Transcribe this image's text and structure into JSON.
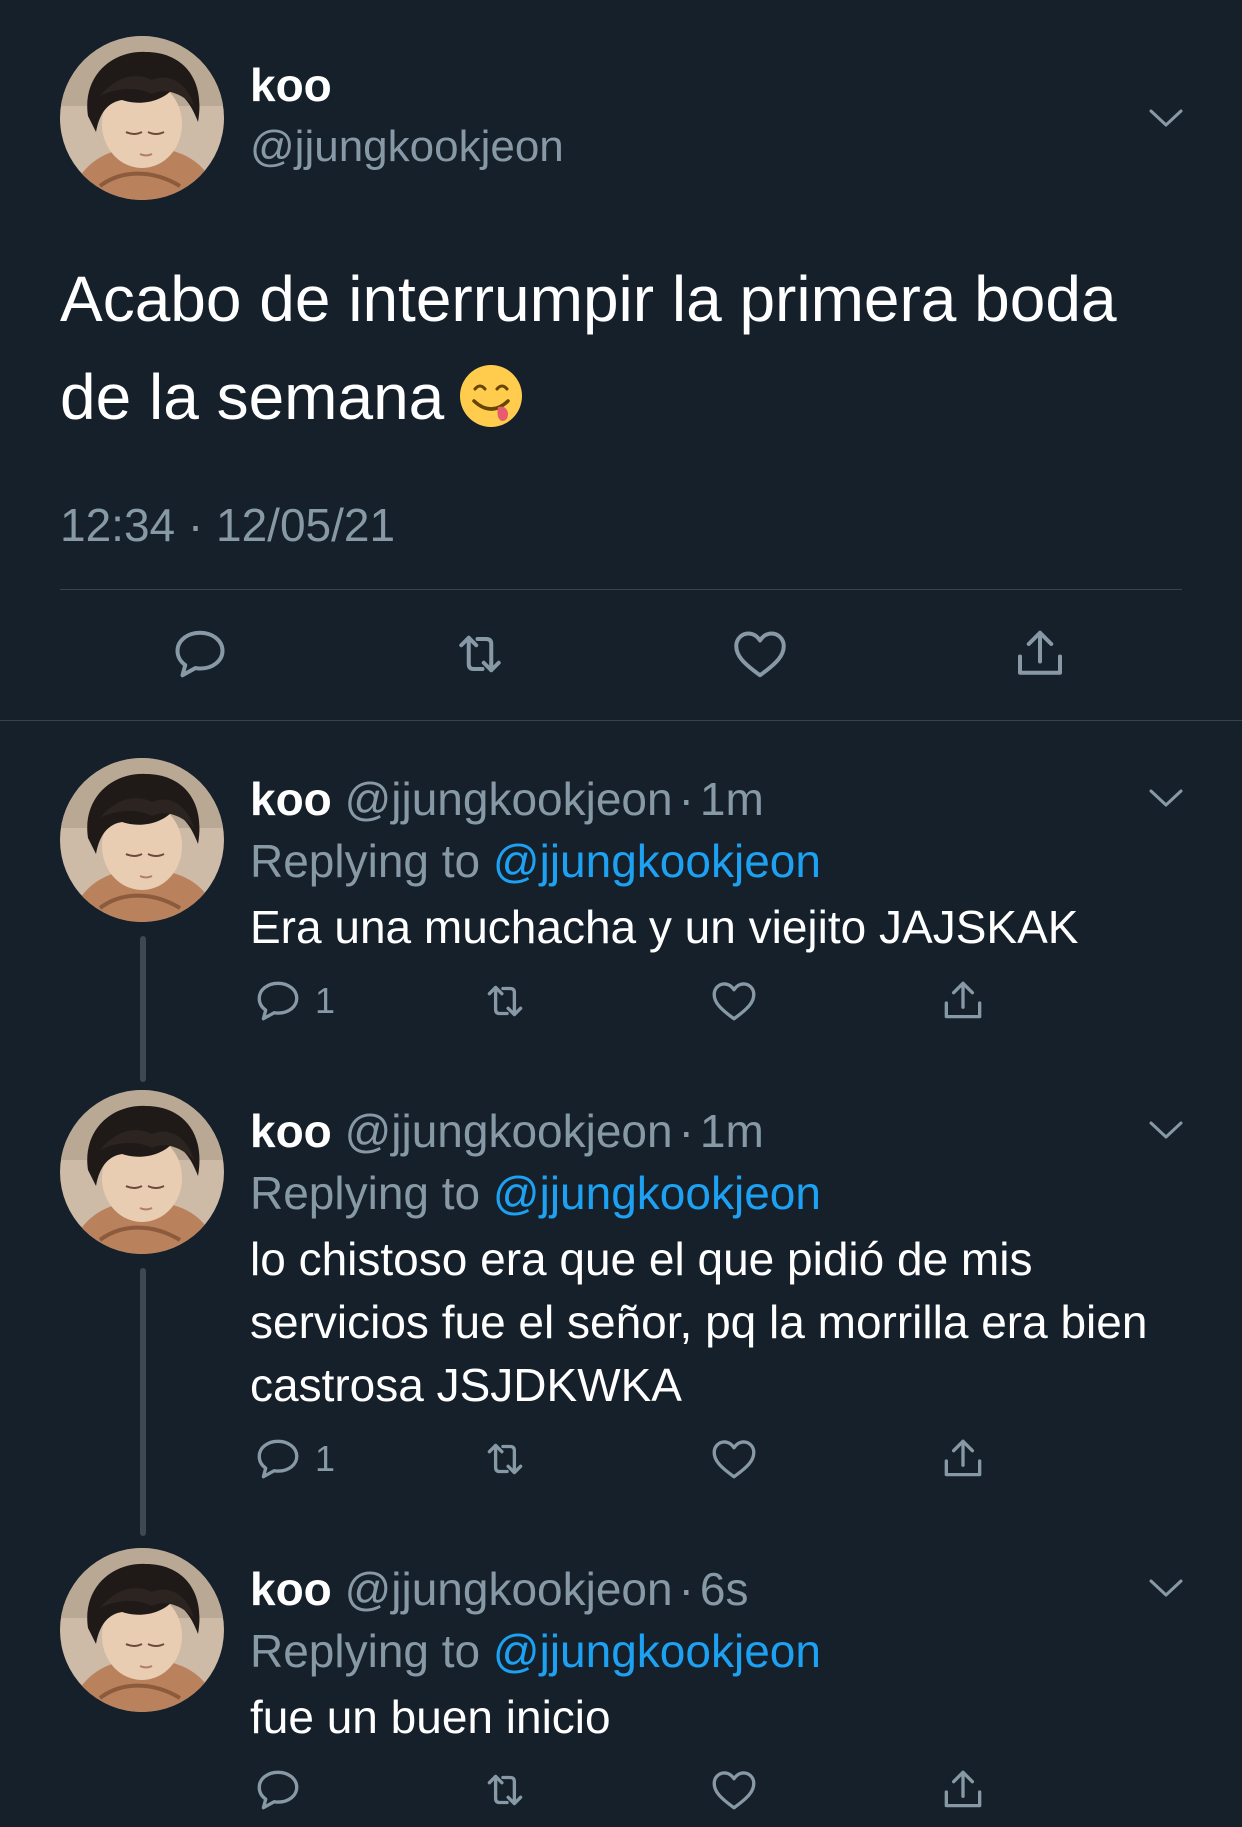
{
  "main_tweet": {
    "name": "koo",
    "handle": "@jjungkookjeon",
    "text": "Acabo de interrumpir la primera boda de la semana",
    "emoji": "face-savoring-food-emoji",
    "timestamp": "12:34 · 12/05/21",
    "actions": [
      "reply-icon",
      "retweet-icon",
      "like-icon",
      "share-icon"
    ]
  },
  "replies": [
    {
      "name": "koo",
      "handle": "@jjungkookjeon",
      "dot": "·",
      "time": "1m",
      "replying_prefix": "Replying to",
      "replying_to": "@jjungkookjeon",
      "text": "Era una muchacha y un viejito JAJSKAK",
      "reply_count": "1"
    },
    {
      "name": "koo",
      "handle": "@jjungkookjeon",
      "dot": "·",
      "time": "1m",
      "replying_prefix": "Replying to",
      "replying_to": "@jjungkookjeon",
      "text": "lo chistoso era que el que pidió de mis servicios fue el señor, pq la morrilla era bien castrosa JSJDKWKA",
      "reply_count": "1"
    },
    {
      "name": "koo",
      "handle": "@jjungkookjeon",
      "dot": "·",
      "time": "6s",
      "replying_prefix": "Replying to",
      "replying_to": "@jjungkookjeon",
      "text": "fue un buen inicio",
      "reply_count": ""
    }
  ],
  "colors": {
    "background": "#15202b",
    "text": "#ffffff",
    "secondary": "#8899a6",
    "link": "#1da1f2",
    "divider": "#38444d"
  }
}
